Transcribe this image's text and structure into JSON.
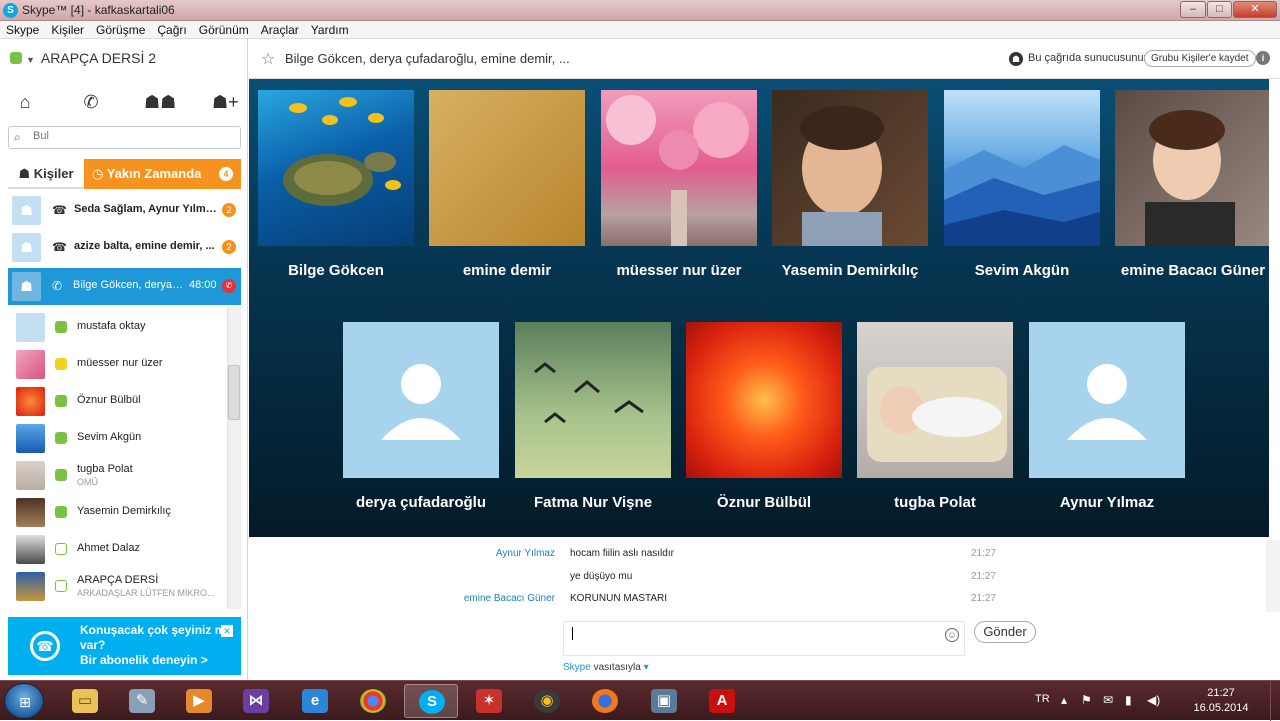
{
  "window": {
    "title": "Skype™ [4] - kafkaskartali06"
  },
  "menu": [
    "Skype",
    "Kişiler",
    "Görüşme",
    "Çağrı",
    "Görünüm",
    "Araçlar",
    "Yardım"
  ],
  "sidebar": {
    "status_name": "ARAPÇA DERSİ 2",
    "search_placeholder": "Bul",
    "tab_contacts": "Kişiler",
    "tab_recent": "Yakın Zamanda",
    "tab_recent_badge": "4",
    "recent": [
      {
        "name": "Seda Sağlam, Aynur Yılmaz, ...",
        "badge": "2"
      },
      {
        "name": "azize balta, emine demir, ...",
        "badge": "2"
      },
      {
        "name": "Bilge Gökcen, derya çufadaroğlu, ...",
        "time": "48:00"
      }
    ],
    "contacts": [
      {
        "name": "mustafa oktay",
        "status": "online",
        "sub": ""
      },
      {
        "name": "müesser nur üzer",
        "status": "away",
        "sub": ""
      },
      {
        "name": "Öznur Bülbül",
        "status": "online",
        "sub": ""
      },
      {
        "name": "Sevim Akgün",
        "status": "online",
        "sub": ""
      },
      {
        "name": "tugba Polat",
        "status": "online",
        "sub": "OMÜ"
      },
      {
        "name": "Yasemin Demirkılıç",
        "status": "online",
        "sub": ""
      },
      {
        "name": "Ahmet Dalaz",
        "status": "offline",
        "sub": ""
      },
      {
        "name": "ARAPÇA DERSİ",
        "status": "offline",
        "sub": "ARKADAŞLAR LÜTFEN MİKRO..."
      }
    ],
    "promo": {
      "line1": "Konuşacak çok şeyiniz mi var?",
      "line2": "Bir abonelik deneyin >"
    }
  },
  "conversation": {
    "title": "Bilge Gökcen, derya çufadaroğlu, emine demir, ...",
    "host_text": "Bu çağrıda sunucusunuz",
    "save_group": "Grubu Kişiler'e kaydet",
    "watermark": "skype",
    "participants": [
      {
        "name": "Bilge Gökcen"
      },
      {
        "name": "emine demir"
      },
      {
        "name": "müesser nur üzer"
      },
      {
        "name": "Yasemin Demirkılıç"
      },
      {
        "name": "Sevim Akgün"
      },
      {
        "name": "emine Bacacı Güner"
      },
      {
        "name": "derya çufadaroğlu"
      },
      {
        "name": "Fatma Nur Vişne"
      },
      {
        "name": "Öznur Bülbül"
      },
      {
        "name": "tugba Polat"
      },
      {
        "name": "Aynur Yılmaz"
      }
    ]
  },
  "chat": {
    "messages": [
      {
        "sender": "Aynur Yılmaz",
        "text": "hocam fiilin aslı nasıldır",
        "time": "21:27"
      },
      {
        "sender": "",
        "text": "ye düşüyo mu",
        "time": "21:27"
      },
      {
        "sender": "emine Bacacı Güner",
        "text": "KORUNUN MASTARI",
        "time": "21:27"
      }
    ],
    "send_label": "Gönder",
    "via_brand": "Skype",
    "via_text": "vasıtasıyla"
  },
  "taskbar": {
    "lang": "TR",
    "time": "21:27",
    "date": "16.05.2014"
  },
  "colors": {
    "skype_blue": "#00aff0",
    "recent_orange": "#f6921e",
    "online_green": "#7cc242",
    "selected_blue": "#1e98d6"
  }
}
